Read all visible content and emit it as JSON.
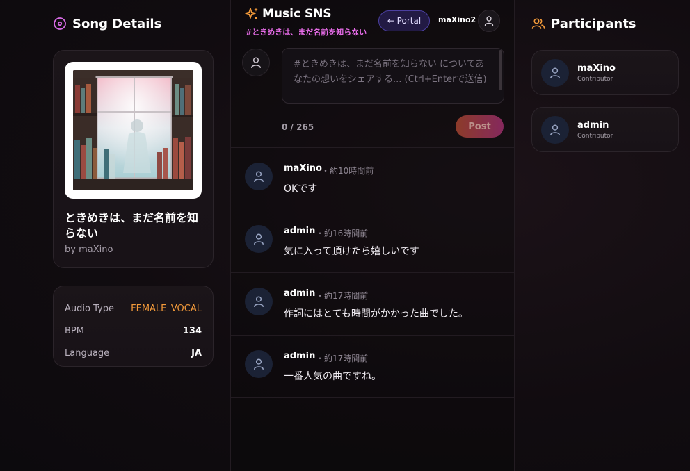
{
  "song_details": {
    "title": "Song Details",
    "song_title": "ときめきは、まだ名前を知らない",
    "artist": "by maXino",
    "meta": [
      {
        "key": "Audio Type",
        "value": "FEMALE_VOCAL"
      },
      {
        "key": "BPM",
        "value": "134"
      },
      {
        "key": "Language",
        "value": "JA"
      }
    ]
  },
  "header": {
    "brand": "Music SNS",
    "tagline": "#ときめきは、まだ名前を知らない",
    "portal_label": "← Portal",
    "username": "maXino2"
  },
  "composer": {
    "placeholder": "#ときめきは、まだ名前を知らない についてあなたの想いをシェアする... (Ctrl+Enterで送信)",
    "counter": "0 / 265",
    "post_label": "Post"
  },
  "posts": [
    {
      "author": "maXino",
      "time": "・約10時間前",
      "body": "OKです"
    },
    {
      "author": "admin",
      "time": "・約16時間前",
      "body": "気に入って頂けたら嬉しいです"
    },
    {
      "author": "admin",
      "time": "・約17時間前",
      "body": "作詞にはとても時間がかかった曲でした。"
    },
    {
      "author": "admin",
      "time": "・約17時間前",
      "body": "一番人気の曲ですね。"
    }
  ],
  "participants": {
    "title": "Participants",
    "items": [
      {
        "name": "maXino",
        "role": "Contributor"
      },
      {
        "name": "admin",
        "role": "Contributor"
      }
    ]
  },
  "colors": {
    "accent_orange": "#f39a3a",
    "accent_pink": "#e56be6",
    "portal_purple": "#4b3fa0"
  }
}
